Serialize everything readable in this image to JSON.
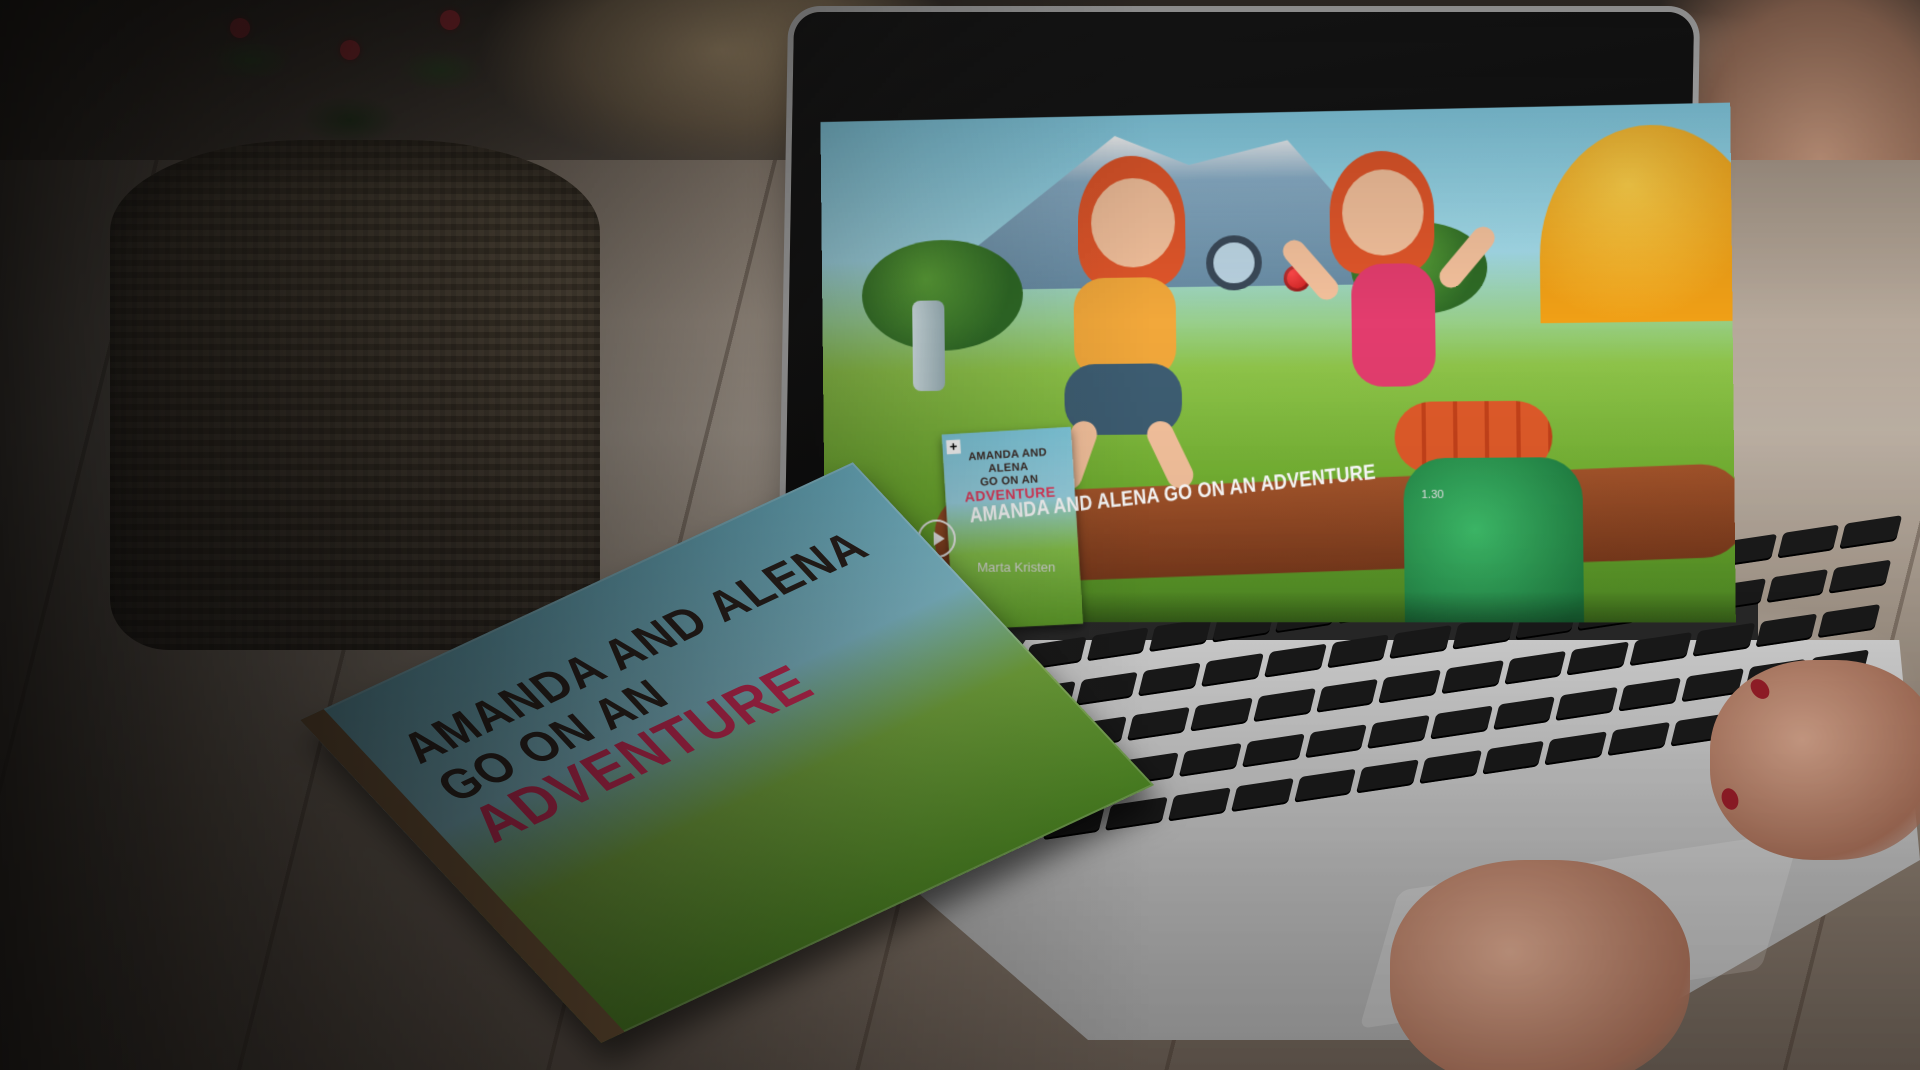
{
  "video": {
    "title": "AMANDA AND ALENA GO ON AN ADVENTURE",
    "author": "Marta Kristen",
    "duration": "1.30",
    "play_icon": "play-icon"
  },
  "thumbnail": {
    "add_label": "+",
    "title_line1": "AMANDA AND ALENA",
    "title_line2_prefix": "GO ON AN ",
    "title_highlight": "ADVENTURE"
  },
  "book": {
    "title_line1": "AMANDA AND ALENA",
    "title_line2_prefix": "GO ON AN ",
    "title_highlight": "ADVENTURE"
  },
  "colors": {
    "title_highlight": "#e23a5b",
    "nail_polish": "#9c1e2a"
  }
}
